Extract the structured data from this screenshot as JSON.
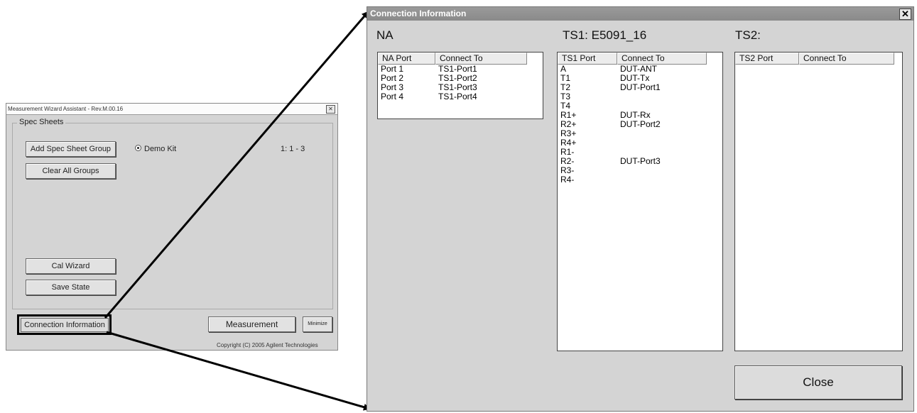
{
  "small_window": {
    "title": "Measurement Wizard Assistant - Rev.M.00.16",
    "close_glyph": "✕",
    "group_label": "Spec Sheets",
    "add_button": "Add Spec Sheet Group",
    "clear_button": "Clear All Groups",
    "radio_label": "Demo Kit",
    "range_text": "1: 1 - 3",
    "cal_wizard_button": "Cal Wizard",
    "save_state_button": "Save State",
    "connection_button": "Connection Information",
    "measurement_button": "Measurement",
    "minimize_button": "Minimize",
    "copyright": "Copyright (C) 2005 Agilent Technologies"
  },
  "big_window": {
    "title": "Connection Information",
    "close_glyph": "✕",
    "na": {
      "title": "NA",
      "columns": [
        "NA Port",
        "Connect To"
      ],
      "rows": [
        [
          "Port 1",
          "TS1-Port1"
        ],
        [
          "Port 2",
          "TS1-Port2"
        ],
        [
          "Port 3",
          "TS1-Port3"
        ],
        [
          "Port 4",
          "TS1-Port4"
        ]
      ]
    },
    "ts1": {
      "title": "TS1: E5091_16",
      "columns": [
        "TS1 Port",
        "Connect To"
      ],
      "rows": [
        [
          "A",
          "DUT-ANT"
        ],
        [
          "T1",
          "DUT-Tx"
        ],
        [
          "T2",
          "DUT-Port1"
        ],
        [
          "T3",
          ""
        ],
        [
          "T4",
          ""
        ],
        [
          "R1+",
          "DUT-Rx"
        ],
        [
          "R2+",
          "DUT-Port2"
        ],
        [
          "R3+",
          ""
        ],
        [
          "R4+",
          ""
        ],
        [
          "R1-",
          ""
        ],
        [
          "R2-",
          "DUT-Port3"
        ],
        [
          "R3-",
          ""
        ],
        [
          "R4-",
          ""
        ]
      ]
    },
    "ts2": {
      "title": "TS2:",
      "columns": [
        "TS2 Port",
        "Connect To"
      ],
      "rows": []
    },
    "close_button": "Close"
  }
}
